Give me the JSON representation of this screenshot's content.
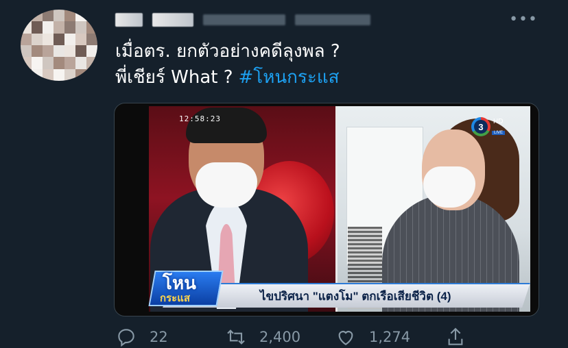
{
  "tweet": {
    "text_line1": "เมื่อตร. ยกตัวอย่างคดีลุงพล ?",
    "text_line2_prefix": "พี่เชียร์ What ?",
    "hashtag": "#โหนกระแส"
  },
  "media": {
    "timestamp": "12:58:23",
    "channel_number": "3",
    "channel_suffix": "HD",
    "channel_live": "LIVE",
    "show_logo_line1": "โหน",
    "show_logo_line2": "กระแส",
    "lower_third": "ไขปริศนา \"แตงโม\" ตกเรือเสียชีวิต (4)"
  },
  "actions": {
    "replies": "22",
    "retweets": "2,400",
    "likes": "1,274"
  },
  "colors": {
    "background": "#15202b",
    "text": "#ffffff",
    "muted": "#8899a6",
    "hashtag": "#1da1f2"
  },
  "icons": {
    "more": "more-icon",
    "reply": "reply-icon",
    "retweet": "retweet-icon",
    "like": "heart-icon",
    "share": "share-icon"
  }
}
